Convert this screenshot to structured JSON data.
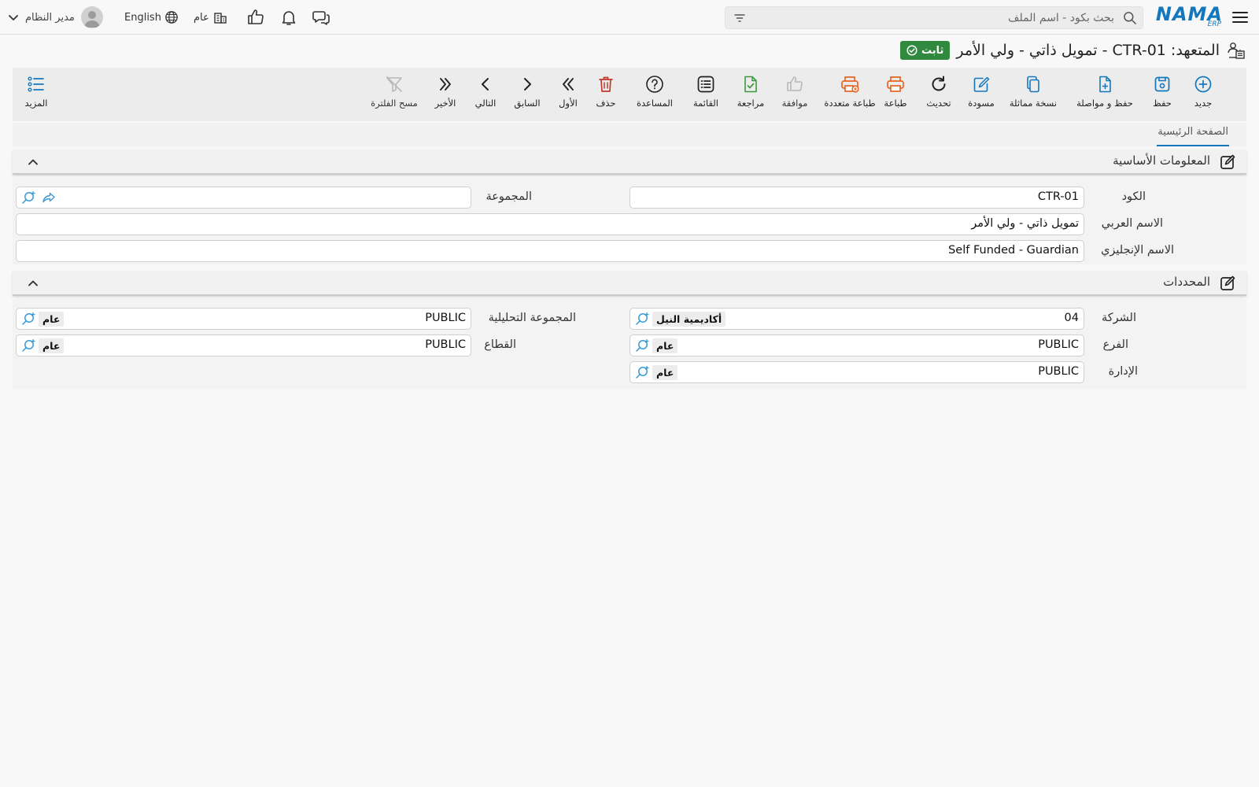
{
  "topbar": {
    "logo_text": "NAMA",
    "logo_sub": "ERP",
    "search_placeholder": "بحث بكود - اسم الملف",
    "branch_label": "عام",
    "language_label": "English",
    "user_name": "مدير النظام"
  },
  "title": {
    "text": "المتعهد: CTR-01 - تمويل ذاتي - ولي الأمر",
    "status": "ثابت"
  },
  "toolbar": {
    "new": "جديد",
    "save": "حفظ",
    "save_continue": "حفظ و مواصلة",
    "duplicate": "نسخة مماثلة",
    "draft": "مسودة",
    "refresh": "تحديث",
    "print": "طباعة",
    "multi_print": "طباعة متعددة",
    "approve": "موافقة",
    "review": "مراجعة",
    "list": "القائمة",
    "help": "المساعدة",
    "delete": "حذف",
    "first": "الأول",
    "previous": "السابق",
    "next": "التالي",
    "last": "الأخير",
    "clear_filter": "مسح الفلترة",
    "more": "المزيد"
  },
  "tabs": {
    "main": "الصفحة الرئيسية"
  },
  "basic_info": {
    "title": "المعلومات الأساسية",
    "code_label": "الكود",
    "code_value": "CTR-01",
    "group_label": "المجموعة",
    "group_value": "",
    "arabic_name_label": "الاسم العربي",
    "arabic_name_value": "تمويل ذاتي - ولي الأمر",
    "english_name_label": "الاسم الإنجليزي",
    "english_name_value": "Self Funded - Guardian"
  },
  "dimensions": {
    "title": "المحددات",
    "company_label": "الشركة",
    "company_code": "04",
    "company_name": "أكاديمية النيل",
    "analytic_group_label": "المجموعة التحليلية",
    "analytic_group_code": "PUBLIC",
    "analytic_group_name": "عام",
    "branch_label": "الفرع",
    "branch_code": "PUBLIC",
    "branch_name": "عام",
    "sector_label": "القطاع",
    "sector_code": "PUBLIC",
    "sector_name": "عام",
    "department_label": "الإدارة",
    "department_code": "PUBLIC",
    "department_name": "عام"
  },
  "colors": {
    "accent": "#1477bd",
    "status_green": "#2f8a3f",
    "orange": "#e8641f",
    "delete_red": "#c0392b",
    "review_green": "#3a9a3f"
  }
}
